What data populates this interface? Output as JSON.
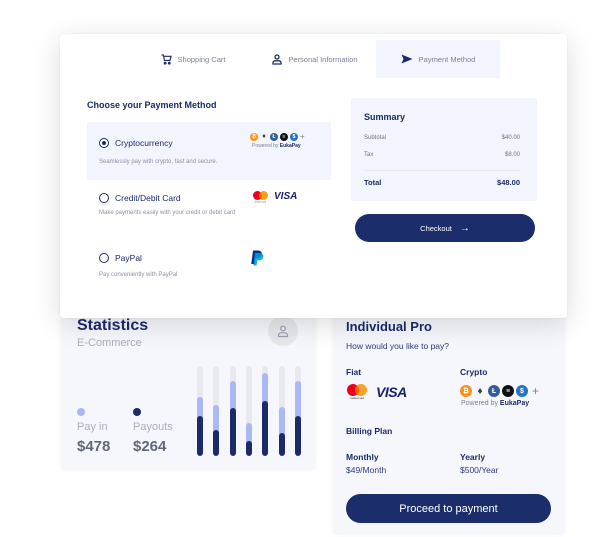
{
  "checkout_modal": {
    "tabs": [
      {
        "label": "Shopping Cart",
        "icon": "cart-icon",
        "active": false
      },
      {
        "label": "Personal Information",
        "icon": "person-icon",
        "active": false
      },
      {
        "label": "Payment Method",
        "icon": "send-icon",
        "active": true
      }
    ],
    "section_title": "Choose your Payment Method",
    "options": [
      {
        "label": "Cryptocurrency",
        "description": "Seamlessly pay with crypto, fast and secure.",
        "selected": true
      },
      {
        "label": "Credit/Debit Card",
        "description": "Make payments easily with your credit or debit card",
        "selected": false
      },
      {
        "label": "PayPal",
        "description": "Pay conveniently with PayPal",
        "selected": false
      }
    ],
    "crypto_badge": {
      "coins": [
        "bitcoin-icon",
        "ethereum-icon",
        "litecoin-icon",
        "stacks-icon",
        "usdc-icon"
      ],
      "more": "+",
      "powered_by": "Powered by",
      "brand": "EukaPay"
    },
    "card_brands": {
      "visa": "VISA",
      "mastercard_text": "mastercard"
    },
    "summary": {
      "title": "Summary",
      "rows": [
        {
          "label": "Subtotal",
          "value": "$40.00"
        },
        {
          "label": "Tax",
          "value": "$8.00"
        }
      ],
      "total_label": "Total",
      "total_value": "$48.00"
    },
    "checkout_label": "Checkout",
    "checkout_arrow": "→"
  },
  "statistics_card": {
    "title": "Statistics",
    "subtitle": "E-Commerce",
    "legend": [
      {
        "label": "Pay in",
        "value": "$478",
        "color": "#aab8f4"
      },
      {
        "label": "Payouts",
        "value": "$264",
        "color": "#1b2a6b"
      }
    ],
    "bars": [
      {
        "pay_in": 0.66,
        "payouts": 0.45
      },
      {
        "pay_in": 0.57,
        "payouts": 0.29
      },
      {
        "pay_in": 0.83,
        "payouts": 0.53
      },
      {
        "pay_in": 0.37,
        "payouts": 0.17
      },
      {
        "pay_in": 0.92,
        "payouts": 0.61
      },
      {
        "pay_in": 0.55,
        "payouts": 0.26
      },
      {
        "pay_in": 0.83,
        "payouts": 0.45
      }
    ]
  },
  "pro_card": {
    "title": "Individual Pro",
    "subtitle": "How would you like to pay?",
    "fiat_label": "Fiat",
    "crypto_label": "Crypto",
    "billing_label": "Billing Plan",
    "plans": [
      {
        "name": "Monthly",
        "price": "$49/Month"
      },
      {
        "name": "Yearly",
        "price": "$500/Year"
      }
    ],
    "proceed_label": "Proceed to payment"
  },
  "colors": {
    "primary": "#1b2d6b",
    "accent_light": "#aab8f4",
    "panel_bg": "#f2f5fd"
  }
}
